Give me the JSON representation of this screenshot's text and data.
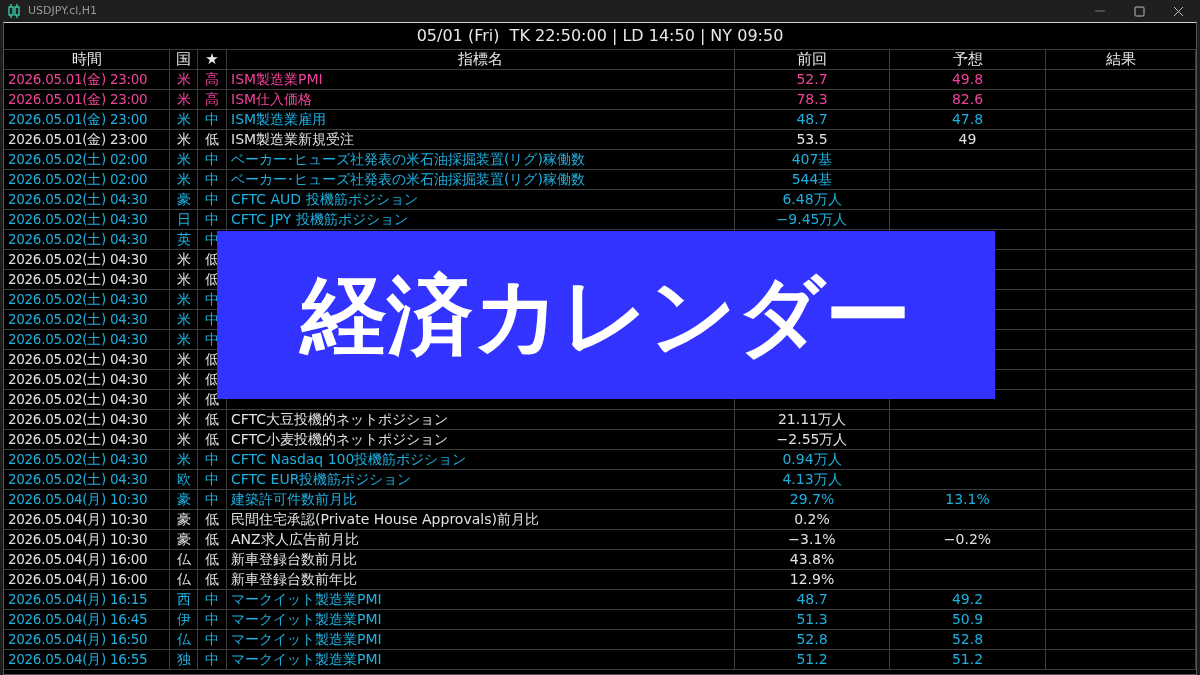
{
  "window": {
    "title": "USDJPY.cl,H1"
  },
  "clock": "05/01 (Fri)  TK 22:50:00 | LD 14:50 | NY 09:50",
  "columns": [
    "時間",
    "国",
    "★",
    "指標名",
    "前回",
    "予想",
    "結果"
  ],
  "rows": [
    {
      "kind": "high",
      "time": "2026.05.01(金) 23:00",
      "country": "米",
      "importance": "高",
      "name": "ISM製造業PMI",
      "previous": "52.7",
      "forecast": "49.8"
    },
    {
      "kind": "high",
      "time": "2026.05.01(金) 23:00",
      "country": "米",
      "importance": "高",
      "name": "ISM仕入価格",
      "previous": "78.3",
      "forecast": "82.6"
    },
    {
      "kind": "mid",
      "time": "2026.05.01(金) 23:00",
      "country": "米",
      "importance": "中",
      "name": "ISM製造業雇用",
      "previous": "48.7",
      "forecast": "47.8"
    },
    {
      "kind": "low",
      "time": "2026.05.01(金) 23:00",
      "country": "米",
      "importance": "低",
      "name": "ISM製造業新規受注",
      "previous": "53.5",
      "forecast": "49"
    },
    {
      "kind": "mid",
      "time": "2026.05.02(土) 02:00",
      "country": "米",
      "importance": "中",
      "name": "ベーカー･ヒューズ社発表の米石油採掘装置(リグ)稼働数",
      "previous": "407基"
    },
    {
      "kind": "mid",
      "time": "2026.05.02(土) 02:00",
      "country": "米",
      "importance": "中",
      "name": "ベーカー･ヒューズ社発表の米石油採掘装置(リグ)稼働数",
      "previous": "544基"
    },
    {
      "kind": "mid",
      "time": "2026.05.02(土) 04:30",
      "country": "豪",
      "importance": "中",
      "name": "CFTC AUD 投機筋ポジション",
      "previous": "6.48万人"
    },
    {
      "kind": "mid",
      "time": "2026.05.02(土) 04:30",
      "country": "日",
      "importance": "中",
      "name": "CFTC JPY 投機筋ポジション",
      "previous": "−9.45万人"
    },
    {
      "kind": "mid",
      "time": "2026.05.02(土) 04:30",
      "country": "英",
      "importance": "中"
    },
    {
      "kind": "low",
      "time": "2026.05.02(土) 04:30",
      "country": "米",
      "importance": "低"
    },
    {
      "kind": "low",
      "time": "2026.05.02(土) 04:30",
      "country": "米",
      "importance": "低"
    },
    {
      "kind": "mid",
      "time": "2026.05.02(土) 04:30",
      "country": "米",
      "importance": "中"
    },
    {
      "kind": "mid",
      "time": "2026.05.02(土) 04:30",
      "country": "米",
      "importance": "中"
    },
    {
      "kind": "mid",
      "time": "2026.05.02(土) 04:30",
      "country": "米",
      "importance": "中"
    },
    {
      "kind": "low",
      "time": "2026.05.02(土) 04:30",
      "country": "米",
      "importance": "低"
    },
    {
      "kind": "low",
      "time": "2026.05.02(土) 04:30",
      "country": "米",
      "importance": "低"
    },
    {
      "kind": "low",
      "time": "2026.05.02(土) 04:30",
      "country": "米",
      "importance": "低"
    },
    {
      "kind": "low",
      "time": "2026.05.02(土) 04:30",
      "country": "米",
      "importance": "低",
      "name": "CFTC大豆投機的ネットポジション",
      "previous": "21.11万人"
    },
    {
      "kind": "low",
      "time": "2026.05.02(土) 04:30",
      "country": "米",
      "importance": "低",
      "name": "CFTC小麦投機的ネットポジション",
      "previous": "−2.55万人"
    },
    {
      "kind": "mid",
      "time": "2026.05.02(土) 04:30",
      "country": "米",
      "importance": "中",
      "name": "CFTC Nasdaq 100投機筋ポジション",
      "previous": "0.94万人"
    },
    {
      "kind": "mid",
      "time": "2026.05.02(土) 04:30",
      "country": "欧",
      "importance": "中",
      "name": "CFTC EUR投機筋ポジション",
      "previous": "4.13万人"
    },
    {
      "kind": "mid",
      "time": "2026.05.04(月) 10:30",
      "country": "豪",
      "importance": "中",
      "name": "建築許可件数前月比",
      "previous": "29.7%",
      "forecast": "13.1%"
    },
    {
      "kind": "low",
      "time": "2026.05.04(月) 10:30",
      "country": "豪",
      "importance": "低",
      "name": "民間住宅承認(Private House Approvals)前月比",
      "previous": "0.2%"
    },
    {
      "kind": "low",
      "time": "2026.05.04(月) 10:30",
      "country": "豪",
      "importance": "低",
      "name": "ANZ求人広告前月比",
      "previous": "−3.1%",
      "forecast": "−0.2%"
    },
    {
      "kind": "low",
      "time": "2026.05.04(月) 16:00",
      "country": "仏",
      "importance": "低",
      "name": "新車登録台数前月比",
      "previous": "43.8%"
    },
    {
      "kind": "low",
      "time": "2026.05.04(月) 16:00",
      "country": "仏",
      "importance": "低",
      "name": "新車登録台数前年比",
      "previous": "12.9%"
    },
    {
      "kind": "mid",
      "time": "2026.05.04(月) 16:15",
      "country": "西",
      "importance": "中",
      "name": "マークイット製造業PMI",
      "previous": "48.7",
      "forecast": "49.2"
    },
    {
      "kind": "mid",
      "time": "2026.05.04(月) 16:45",
      "country": "伊",
      "importance": "中",
      "name": "マークイット製造業PMI",
      "previous": "51.3",
      "forecast": "50.9"
    },
    {
      "kind": "mid",
      "time": "2026.05.04(月) 16:50",
      "country": "仏",
      "importance": "中",
      "name": "マークイット製造業PMI",
      "previous": "52.8",
      "forecast": "52.8"
    },
    {
      "kind": "mid",
      "time": "2026.05.04(月) 16:55",
      "country": "独",
      "importance": "中",
      "name": "マークイット製造業PMI",
      "previous": "51.2",
      "forecast": "51.2"
    }
  ],
  "banner": {
    "title": "経済カレンダー"
  }
}
